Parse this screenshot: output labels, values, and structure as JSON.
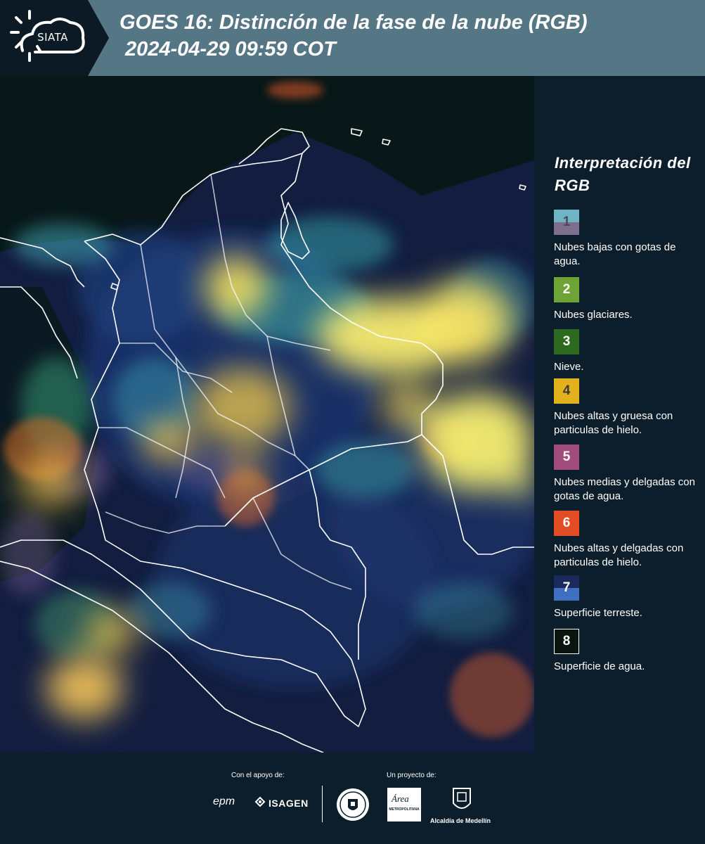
{
  "header": {
    "logo_text": "SIATA",
    "title": "GOES 16: Distinción de la fase de la nube (RGB)",
    "datetime": "2024-04-29 09:59 COT"
  },
  "map": {
    "background_color": "#121d40",
    "border_color": "#ffffff"
  },
  "legend": {
    "title": "Interpretación del RGB",
    "items": [
      {
        "number": "1",
        "description": "Nubes bajas con gotas de agua.",
        "color_top": "#6fb4c4",
        "color_bottom": "#7e6f8f",
        "text_color": "#4a4a5a"
      },
      {
        "number": "2",
        "description": "Nubes glaciares.",
        "color_top": "#6da435",
        "color_bottom": "#6da435",
        "text_color": "#ffffff"
      },
      {
        "number": "3",
        "description": "Nieve.",
        "color_top": "#2d6a1f",
        "color_bottom": "#2d6a1f",
        "text_color": "#ffffff"
      },
      {
        "number": "4",
        "description": "Nubes altas y gruesa con particulas de hielo.",
        "color_top": "#e1b21c",
        "color_bottom": "#e1b21c",
        "text_color": "#3a3a3a"
      },
      {
        "number": "5",
        "description": "Nubes medias y delgadas con gotas de agua.",
        "color_top": "#a24c7c",
        "color_bottom": "#a24c7c",
        "text_color": "#ffffff"
      },
      {
        "number": "6",
        "description": "Nubes altas y delgadas con particulas de hielo.",
        "color_top": "#e24c23",
        "color_bottom": "#e24c23",
        "text_color": "#ffffff"
      },
      {
        "number": "7",
        "description": "Superficie terreste.",
        "color_top": "#1a2a5c",
        "color_bottom": "#3f6fc0",
        "text_color": "#ffffff"
      },
      {
        "number": "8",
        "description": "Superficie de agua.",
        "color_top": "#0a1510",
        "color_bottom": "#0a1510",
        "text_color": "#ffffff"
      }
    ]
  },
  "footer": {
    "support_label": "Con el apoyo de:",
    "project_label": "Un proyecto de:",
    "epm": "epm",
    "isagen": "ISAGEN",
    "area_script": "Área",
    "area_text": "METROPOLITANA",
    "medellin": "Alcaldía de Medellín"
  }
}
